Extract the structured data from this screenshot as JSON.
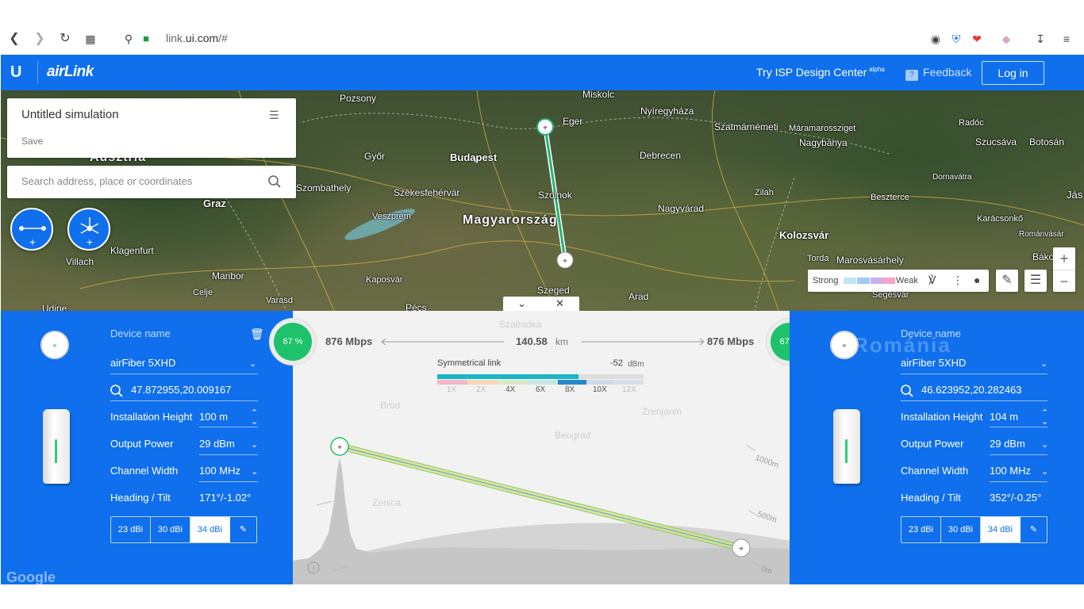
{
  "browser": {
    "url_prefix": "link.",
    "url_host": "ui.com",
    "url_path": "/#"
  },
  "header": {
    "brand": "airLink",
    "isp_link": "Try ISP Design Center",
    "isp_badge": "alpha",
    "feedback": "Feedback",
    "login": "Log in"
  },
  "simulation": {
    "title": "Untitled simulation",
    "save": "Save"
  },
  "search": {
    "placeholder": "Search address, place or coordinates"
  },
  "map": {
    "labels": {
      "pozsony": "Pozsony",
      "miskolc": "Miskolc",
      "nyiregyhaza": "Nyíregyháza",
      "eger": "Eger",
      "szatmarnemeti": "Szatmárnémeti",
      "maramarossziget": "Máramarossziget",
      "radoc": "Radóc",
      "gyor": "Győr",
      "budapest": "Budapest",
      "debrecen": "Debrecen",
      "nagybanya": "Nagybánya",
      "szucsava": "Szucsáva",
      "botosan": "Botosán",
      "ausztria": "Ausztria",
      "szekesfehervar": "Székesfehérvár",
      "szolnok": "Szolnok",
      "zilah": "Zilah",
      "beszterce": "Beszterce",
      "dornavatra": "Dornavátra",
      "jas": "Jás",
      "szombathely": "Szombathely",
      "graz": "Graz",
      "veszprem": "Veszprém",
      "magyarorszag": "Magyarország",
      "nagyvarad": "Nagyvárad",
      "karacsonko": "Karácsonkő",
      "klagenfurt": "Klagenfurt",
      "kolozsvar": "Kolozsvár",
      "romanvasar": "Románvásár",
      "villach": "Villach",
      "torda": "Torda",
      "marosvasarhely": "Marosvásárhely",
      "bako": "Bákó",
      "maribor": "Maribor",
      "kaposvar": "Kaposvár",
      "celje": "Celje",
      "szeged": "Szeged",
      "arad": "Arad",
      "segesvar": "Segesvár",
      "varasd": "Varasd",
      "udine": "Udine",
      "pecs": "Pécs"
    },
    "legend": {
      "strong": "Strong",
      "weak": "Weak",
      "colors": [
        "#bfe6f7",
        "#9fc8f5",
        "#c5b2ec",
        "#f4a6c8"
      ]
    }
  },
  "link": {
    "left_percent": "67 %",
    "right_percent": "67 %",
    "left_throughput": "876 Mbps",
    "right_throughput": "876 Mbps",
    "distance_value": "140.58",
    "distance_unit": "km",
    "link_type": "Symmetrical link",
    "signal_value": "-52",
    "signal_unit": "dBm",
    "modulation_levels": [
      "1X",
      "2X",
      "4X",
      "6X",
      "8X",
      "10X",
      "12X"
    ],
    "active_modulation": "8X",
    "profile_labels": {
      "m1000": "1000m",
      "m500": "500m",
      "m0": "0m"
    }
  },
  "left_device": {
    "device_name_label": "Device name",
    "device_name": "airFiber 5XHD",
    "coordinates": "47.872955,20.009167",
    "installation_height_label": "Installation Height",
    "installation_height": "100 m",
    "output_power_label": "Output Power",
    "output_power": "29 dBm",
    "channel_width_label": "Channel Width",
    "channel_width": "100 MHz",
    "heading_tilt_label": "Heading / Tilt",
    "heading_tilt": "171°/-1.02°",
    "gains": [
      "23 dBi",
      "30 dBi",
      "34 dBi"
    ],
    "selected_gain": "34 dBi"
  },
  "right_device": {
    "device_name_label": "Device name",
    "device_name": "airFiber 5XHD",
    "coordinates": "46.623952,20.282463",
    "installation_height_label": "Installation Height",
    "installation_height": "104 m",
    "output_power_label": "Output Power",
    "output_power": "29 dBm",
    "channel_width_label": "Channel Width",
    "channel_width": "100 MHz",
    "heading_tilt_label": "Heading / Tilt",
    "heading_tilt": "352°/-0.25°",
    "gains": [
      "23 dBi",
      "30 dBi",
      "34 dBi"
    ],
    "selected_gain": "34 dBi"
  },
  "colors": {
    "accent": "#0f6fec",
    "success": "#1ec26a",
    "link_line": "#1fb37a"
  }
}
